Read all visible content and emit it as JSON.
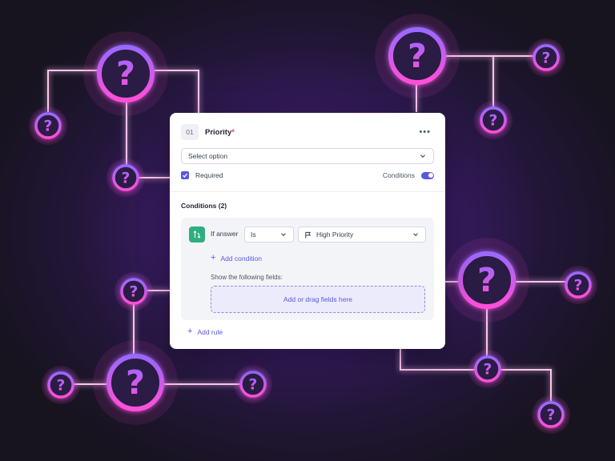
{
  "field": {
    "number": "01",
    "title": "Priority",
    "required_marker": "*",
    "more_icon": "more-horizontal-icon",
    "select_placeholder": "Select option",
    "required_label": "Required",
    "conditions_label": "Conditions",
    "required_checked": true,
    "conditions_enabled": true
  },
  "conditions": {
    "title": "Conditions (2)",
    "rule": {
      "if_label": "If answer",
      "operator": "Is",
      "value": "High Priority"
    },
    "add_condition_label": "Add condition",
    "show_fields_label": "Show the following fields:",
    "dropzone_label": "Add or drag fields here"
  },
  "add_rule_label": "Add rule",
  "colors": {
    "accent": "#5b57e0",
    "branch_icon": "#2fae7f",
    "glow_pink": "#ff4fd8",
    "glow_purple": "#8a5cff",
    "line": "#ffc6ee"
  },
  "decor": {
    "question_glyph": "?"
  }
}
